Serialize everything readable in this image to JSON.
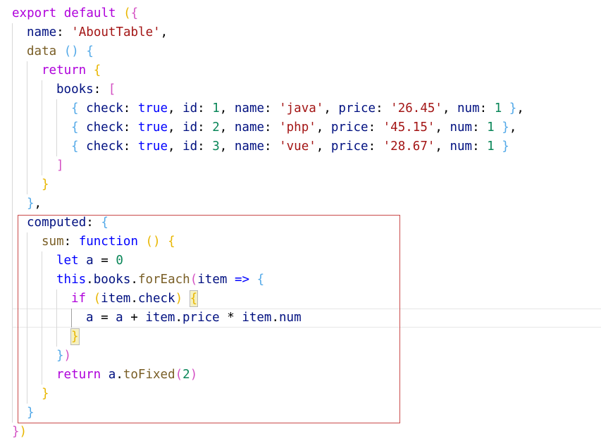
{
  "colors": {
    "keyword": "#af00db",
    "storage": "#0000ff",
    "property": "#001080",
    "function": "#795e26",
    "string": "#a31515",
    "number": "#098658",
    "plain": "#000000",
    "bracket_gold": "#e8b600",
    "bracket_pink": "#d452c4",
    "bracket_blue": "#53a9e8",
    "highlight_box": "#c94a4a"
  },
  "code_lines": [
    {
      "row": 0,
      "indent": 0,
      "tokens": [
        {
          "t": "export",
          "c": "keyword"
        },
        {
          "t": " ",
          "c": "plain"
        },
        {
          "t": "default",
          "c": "keyword"
        },
        {
          "t": " ",
          "c": "plain"
        },
        {
          "t": "(",
          "c": "bracket_gold"
        },
        {
          "t": "{",
          "c": "bracket_pink"
        }
      ]
    },
    {
      "row": 1,
      "indent": 1,
      "tokens": [
        {
          "t": "name",
          "c": "property"
        },
        {
          "t": ": ",
          "c": "plain"
        },
        {
          "t": "'AboutTable'",
          "c": "string"
        },
        {
          "t": ",",
          "c": "plain"
        }
      ]
    },
    {
      "row": 2,
      "indent": 1,
      "tokens": [
        {
          "t": "data",
          "c": "function"
        },
        {
          "t": " ",
          "c": "plain"
        },
        {
          "t": "()",
          "c": "bracket_blue"
        },
        {
          "t": " ",
          "c": "plain"
        },
        {
          "t": "{",
          "c": "bracket_blue"
        }
      ]
    },
    {
      "row": 3,
      "indent": 2,
      "tokens": [
        {
          "t": "return",
          "c": "keyword"
        },
        {
          "t": " ",
          "c": "plain"
        },
        {
          "t": "{",
          "c": "bracket_gold"
        }
      ]
    },
    {
      "row": 4,
      "indent": 3,
      "tokens": [
        {
          "t": "books",
          "c": "property"
        },
        {
          "t": ": ",
          "c": "plain"
        },
        {
          "t": "[",
          "c": "bracket_pink"
        }
      ]
    },
    {
      "row": 5,
      "indent": 4,
      "tokens": [
        {
          "t": "{",
          "c": "bracket_blue"
        },
        {
          "t": " ",
          "c": "plain"
        },
        {
          "t": "check",
          "c": "property"
        },
        {
          "t": ": ",
          "c": "plain"
        },
        {
          "t": "true",
          "c": "storage"
        },
        {
          "t": ", ",
          "c": "plain"
        },
        {
          "t": "id",
          "c": "property"
        },
        {
          "t": ": ",
          "c": "plain"
        },
        {
          "t": "1",
          "c": "number"
        },
        {
          "t": ", ",
          "c": "plain"
        },
        {
          "t": "name",
          "c": "property"
        },
        {
          "t": ": ",
          "c": "plain"
        },
        {
          "t": "'java'",
          "c": "string"
        },
        {
          "t": ", ",
          "c": "plain"
        },
        {
          "t": "price",
          "c": "property"
        },
        {
          "t": ": ",
          "c": "plain"
        },
        {
          "t": "'26.45'",
          "c": "string"
        },
        {
          "t": ", ",
          "c": "plain"
        },
        {
          "t": "num",
          "c": "property"
        },
        {
          "t": ": ",
          "c": "plain"
        },
        {
          "t": "1",
          "c": "number"
        },
        {
          "t": " ",
          "c": "plain"
        },
        {
          "t": "}",
          "c": "bracket_blue"
        },
        {
          "t": ",",
          "c": "plain"
        }
      ]
    },
    {
      "row": 6,
      "indent": 4,
      "tokens": [
        {
          "t": "{",
          "c": "bracket_blue"
        },
        {
          "t": " ",
          "c": "plain"
        },
        {
          "t": "check",
          "c": "property"
        },
        {
          "t": ": ",
          "c": "plain"
        },
        {
          "t": "true",
          "c": "storage"
        },
        {
          "t": ", ",
          "c": "plain"
        },
        {
          "t": "id",
          "c": "property"
        },
        {
          "t": ": ",
          "c": "plain"
        },
        {
          "t": "2",
          "c": "number"
        },
        {
          "t": ", ",
          "c": "plain"
        },
        {
          "t": "name",
          "c": "property"
        },
        {
          "t": ": ",
          "c": "plain"
        },
        {
          "t": "'php'",
          "c": "string"
        },
        {
          "t": ", ",
          "c": "plain"
        },
        {
          "t": "price",
          "c": "property"
        },
        {
          "t": ": ",
          "c": "plain"
        },
        {
          "t": "'45.15'",
          "c": "string"
        },
        {
          "t": ", ",
          "c": "plain"
        },
        {
          "t": "num",
          "c": "property"
        },
        {
          "t": ": ",
          "c": "plain"
        },
        {
          "t": "1",
          "c": "number"
        },
        {
          "t": " ",
          "c": "plain"
        },
        {
          "t": "}",
          "c": "bracket_blue"
        },
        {
          "t": ",",
          "c": "plain"
        }
      ]
    },
    {
      "row": 7,
      "indent": 4,
      "tokens": [
        {
          "t": "{",
          "c": "bracket_blue"
        },
        {
          "t": " ",
          "c": "plain"
        },
        {
          "t": "check",
          "c": "property"
        },
        {
          "t": ": ",
          "c": "plain"
        },
        {
          "t": "true",
          "c": "storage"
        },
        {
          "t": ", ",
          "c": "plain"
        },
        {
          "t": "id",
          "c": "property"
        },
        {
          "t": ": ",
          "c": "plain"
        },
        {
          "t": "3",
          "c": "number"
        },
        {
          "t": ", ",
          "c": "plain"
        },
        {
          "t": "name",
          "c": "property"
        },
        {
          "t": ": ",
          "c": "plain"
        },
        {
          "t": "'vue'",
          "c": "string"
        },
        {
          "t": ", ",
          "c": "plain"
        },
        {
          "t": "price",
          "c": "property"
        },
        {
          "t": ": ",
          "c": "plain"
        },
        {
          "t": "'28.67'",
          "c": "string"
        },
        {
          "t": ", ",
          "c": "plain"
        },
        {
          "t": "num",
          "c": "property"
        },
        {
          "t": ": ",
          "c": "plain"
        },
        {
          "t": "1",
          "c": "number"
        },
        {
          "t": " ",
          "c": "plain"
        },
        {
          "t": "}",
          "c": "bracket_blue"
        }
      ]
    },
    {
      "row": 8,
      "indent": 3,
      "tokens": [
        {
          "t": "]",
          "c": "bracket_pink"
        }
      ]
    },
    {
      "row": 9,
      "indent": 2,
      "tokens": [
        {
          "t": "}",
          "c": "bracket_gold"
        }
      ]
    },
    {
      "row": 10,
      "indent": 1,
      "tokens": [
        {
          "t": "}",
          "c": "bracket_blue"
        },
        {
          "t": ",",
          "c": "plain"
        }
      ]
    },
    {
      "row": 11,
      "indent": 1,
      "tokens": [
        {
          "t": "computed",
          "c": "property"
        },
        {
          "t": ": ",
          "c": "plain"
        },
        {
          "t": "{",
          "c": "bracket_blue"
        }
      ]
    },
    {
      "row": 12,
      "indent": 2,
      "tokens": [
        {
          "t": "sum",
          "c": "function"
        },
        {
          "t": ": ",
          "c": "plain"
        },
        {
          "t": "function",
          "c": "storage"
        },
        {
          "t": " ",
          "c": "plain"
        },
        {
          "t": "()",
          "c": "bracket_gold"
        },
        {
          "t": " ",
          "c": "plain"
        },
        {
          "t": "{",
          "c": "bracket_gold"
        }
      ]
    },
    {
      "row": 13,
      "indent": 3,
      "tokens": [
        {
          "t": "let",
          "c": "storage"
        },
        {
          "t": " ",
          "c": "plain"
        },
        {
          "t": "a",
          "c": "property"
        },
        {
          "t": " = ",
          "c": "plain"
        },
        {
          "t": "0",
          "c": "number"
        }
      ]
    },
    {
      "row": 14,
      "indent": 3,
      "tokens": [
        {
          "t": "this",
          "c": "storage"
        },
        {
          "t": ".",
          "c": "plain"
        },
        {
          "t": "books",
          "c": "property"
        },
        {
          "t": ".",
          "c": "plain"
        },
        {
          "t": "forEach",
          "c": "function"
        },
        {
          "t": "(",
          "c": "bracket_pink"
        },
        {
          "t": "item",
          "c": "property"
        },
        {
          "t": " ",
          "c": "plain"
        },
        {
          "t": "=>",
          "c": "storage"
        },
        {
          "t": " ",
          "c": "plain"
        },
        {
          "t": "{",
          "c": "bracket_blue"
        }
      ]
    },
    {
      "row": 15,
      "indent": 4,
      "tokens": [
        {
          "t": "if",
          "c": "keyword"
        },
        {
          "t": " ",
          "c": "plain"
        },
        {
          "t": "(",
          "c": "bracket_gold"
        },
        {
          "t": "item",
          "c": "property"
        },
        {
          "t": ".",
          "c": "plain"
        },
        {
          "t": "check",
          "c": "property"
        },
        {
          "t": ")",
          "c": "bracket_gold"
        },
        {
          "t": " ",
          "c": "plain"
        },
        {
          "t": "{",
          "c": "bracket_gold",
          "match": true
        }
      ]
    },
    {
      "row": 16,
      "indent": 5,
      "tokens": [
        {
          "t": "a",
          "c": "property"
        },
        {
          "t": " = ",
          "c": "plain"
        },
        {
          "t": "a",
          "c": "property"
        },
        {
          "t": " + ",
          "c": "plain"
        },
        {
          "t": "item",
          "c": "property"
        },
        {
          "t": ".",
          "c": "plain"
        },
        {
          "t": "price",
          "c": "property"
        },
        {
          "t": " * ",
          "c": "plain"
        },
        {
          "t": "item",
          "c": "property"
        },
        {
          "t": ".",
          "c": "plain"
        },
        {
          "t": "num",
          "c": "property"
        }
      ]
    },
    {
      "row": 17,
      "indent": 4,
      "tokens": [
        {
          "t": "}",
          "c": "bracket_gold",
          "match": true
        }
      ]
    },
    {
      "row": 18,
      "indent": 3,
      "tokens": [
        {
          "t": "}",
          "c": "bracket_blue"
        },
        {
          "t": ")",
          "c": "bracket_pink"
        }
      ]
    },
    {
      "row": 19,
      "indent": 3,
      "tokens": [
        {
          "t": "return",
          "c": "keyword"
        },
        {
          "t": " ",
          "c": "plain"
        },
        {
          "t": "a",
          "c": "property"
        },
        {
          "t": ".",
          "c": "plain"
        },
        {
          "t": "toFixed",
          "c": "function"
        },
        {
          "t": "(",
          "c": "bracket_pink"
        },
        {
          "t": "2",
          "c": "number"
        },
        {
          "t": ")",
          "c": "bracket_pink"
        }
      ]
    },
    {
      "row": 20,
      "indent": 2,
      "tokens": [
        {
          "t": "}",
          "c": "bracket_gold"
        }
      ]
    },
    {
      "row": 21,
      "indent": 1,
      "tokens": [
        {
          "t": "}",
          "c": "bracket_blue"
        }
      ]
    },
    {
      "row": 22,
      "indent": 0,
      "tokens": [
        {
          "t": "}",
          "c": "bracket_pink"
        },
        {
          "t": ")",
          "c": "bracket_gold"
        }
      ]
    }
  ]
}
